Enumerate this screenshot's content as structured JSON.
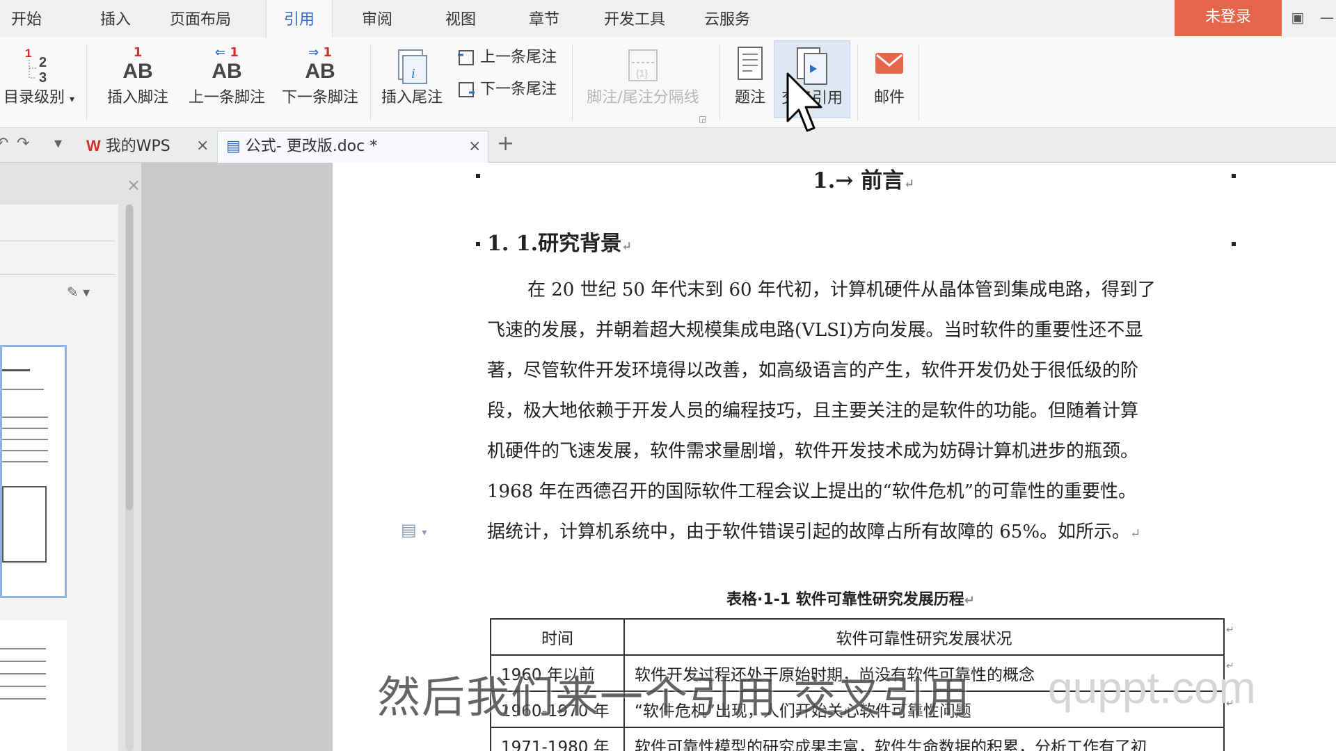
{
  "menu": {
    "tabs": [
      "开始",
      "插入",
      "页面布局",
      "引用",
      "审阅",
      "视图",
      "章节",
      "开发工具",
      "云服务"
    ],
    "active_tab": "引用",
    "login_label": "未登录"
  },
  "ribbon": {
    "toc_level": "目录级别",
    "insert_footnote": "插入脚注",
    "prev_footnote": "上一条脚注",
    "next_footnote": "下一条脚注",
    "ab_text": "AB",
    "superscript_1": "1",
    "insert_endnote": "插入尾注",
    "prev_endnote": "上一条尾注",
    "next_endnote": "下一条尾注",
    "separator": "脚注/尾注分隔线",
    "caption": "题注",
    "cross_reference": "交叉引用",
    "mail": "邮件"
  },
  "doc_tabs": [
    {
      "label": "我的WPS",
      "active": false
    },
    {
      "label": "公式- 更改版.doc *",
      "active": true
    }
  ],
  "document": {
    "heading1": "1.→ 前言",
    "heading2": "1. 1.研究背景",
    "paragraph_lines": [
      "在 20 世纪 50 年代末到 60 年代初，计算机硬件从晶体管到集成电路，得到了",
      "飞速的发展，并朝着超大规模集成电路(VLSI)方向发展。当时软件的重要性还不显",
      "著，尽管软件开发环境得以改善，如高级语言的产生，软件开发仍处于很低级的阶",
      "段，极大地依赖于开发人员的编程技巧，且主要关注的是软件的功能。但随着计算",
      "机硬件的飞速发展，软件需求量剧增，软件开发技术成为妨碍计算机进步的瓶颈。",
      "1968 年在西德召开的国际软件工程会议上提出的“软件危机”的可靠性的重要性。",
      "据统计，计算机系统中，由于软件错误引起的故障占所有故障的 65%。如所示。"
    ],
    "table_caption": "表格·1-1 软件可靠性研究发展历程",
    "table": {
      "headers": [
        "时间",
        "软件可靠性研究发展状况"
      ],
      "rows": [
        [
          "1960 年以前",
          "软件开发过程还处于原始时期，尚没有软件可靠性的概念"
        ],
        [
          "1960-1970 年",
          "“软件危机”出现，人们开始关心软件可靠性问题"
        ],
        [
          "1971-1980 年",
          "软件可靠性模型的研究成果丰富，软件生命数据的积累，分析工作有了初"
        ]
      ]
    }
  },
  "overlay": {
    "subtitle": "然后我们来一个引用 交叉引用",
    "watermark": "quppt.com"
  }
}
